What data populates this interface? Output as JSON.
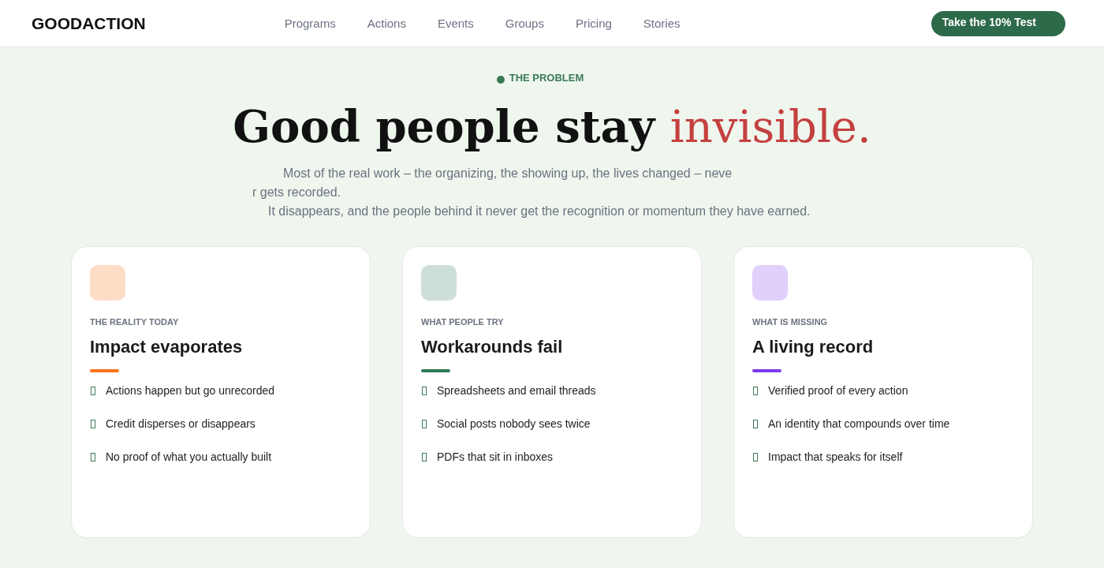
{
  "nav": {
    "logo": "GOODACTION",
    "links": [
      "Programs",
      "Actions",
      "Events",
      "Groups",
      "Pricing",
      "Stories"
    ],
    "cta": "Take the 10% Test"
  },
  "intro": {
    "eyebrow": "THE PROBLEM",
    "headline": "Good people stay",
    "headline_accent": "invisible.",
    "lines": [
      "Most of the real work – the organizing, the showing up, the lives changed – neve",
      "r gets recorded.",
      "It disappears, and the people behind it never get the recognition or momentum they have earned."
    ]
  },
  "cards": [
    {
      "eyebrow": "THE REALITY TODAY",
      "title": "Impact evaporates",
      "color": "#f97316",
      "points": [
        "Actions happen but go unrecorded",
        "Credit disperses or disappears",
        "No proof of what you actually built"
      ]
    },
    {
      "eyebrow": "WHAT PEOPLE TRY",
      "title": "Workarounds fail",
      "color": "#2f7a55",
      "points": [
        "Spreadsheets and email threads",
        "Social posts nobody sees twice",
        "PDFs that sit in inboxes"
      ]
    },
    {
      "eyebrow": "WHAT IS MISSING",
      "title": "A living record",
      "color": "#7c3aed",
      "points": [
        "Verified proof of every action",
        "An identity that compounds over time",
        "Impact that speaks for itself"
      ]
    }
  ]
}
